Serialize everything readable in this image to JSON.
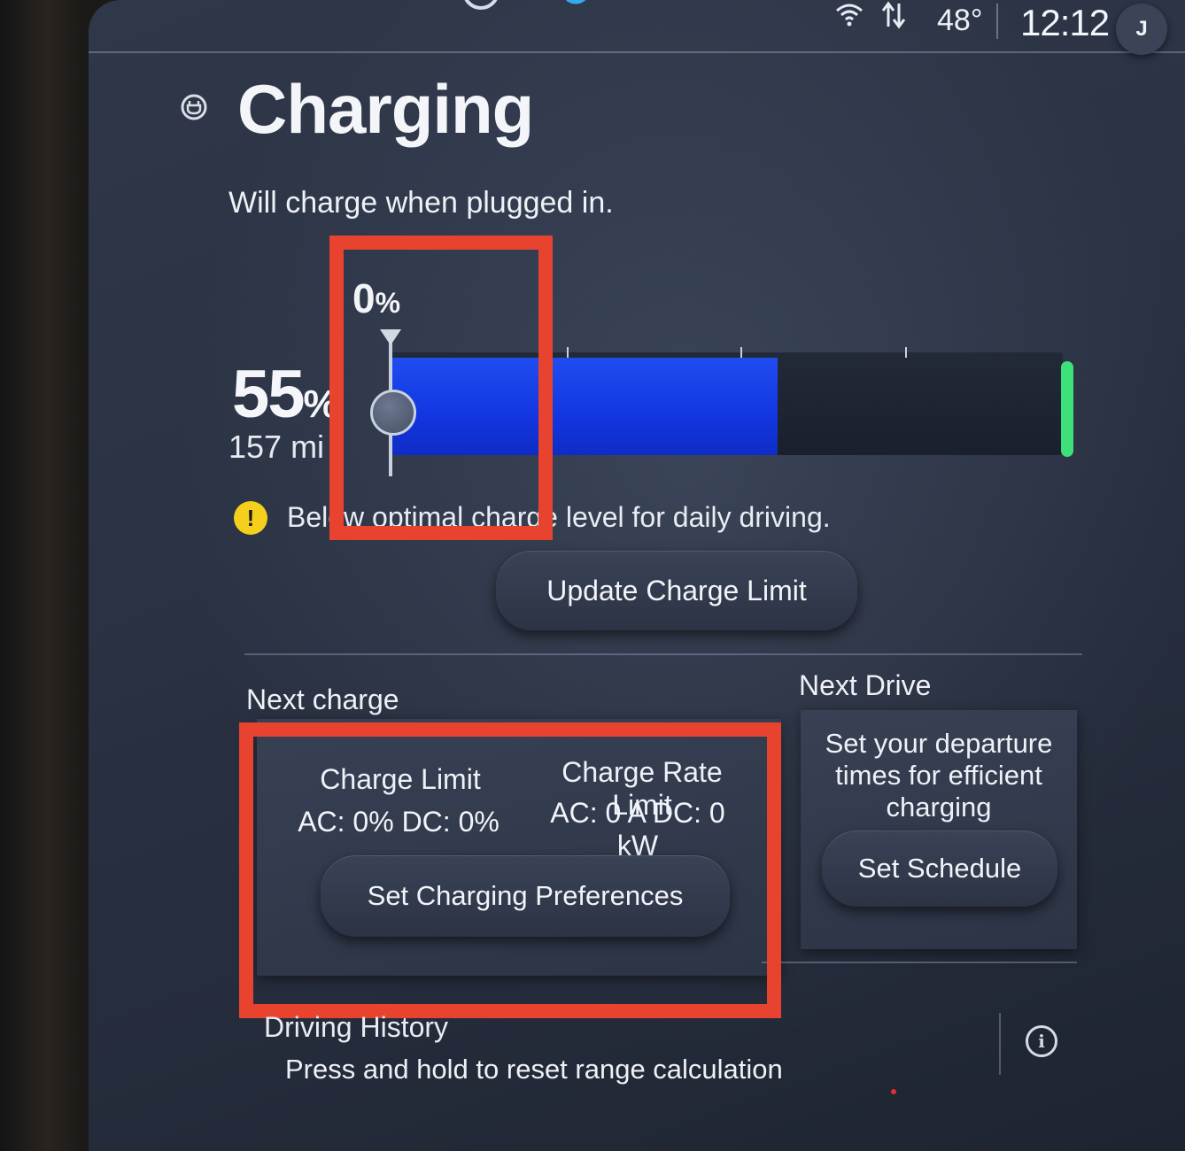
{
  "status_bar": {
    "temperature": "48°",
    "time": "12:12",
    "profile_initial": "J"
  },
  "header": {
    "title": "Charging",
    "status_message": "Will charge when plugged in."
  },
  "battery": {
    "state_of_charge": "55",
    "percent_sign": "%",
    "range": "157 mi",
    "charge_limit_label": "0",
    "charge_limit_unit": "%",
    "charge_fraction": 0.55,
    "colors": {
      "fill": "#1236e0",
      "end_marker": "#3ee07a"
    }
  },
  "warning": {
    "text": "Below optimal charge level for daily driving.",
    "color": "#f4d01c"
  },
  "update_button": {
    "label": "Update Charge Limit"
  },
  "next_charge": {
    "section_label": "Next charge",
    "charge_limit_heading": "Charge Limit",
    "charge_limit_values": "AC: 0% DC: 0%",
    "charge_rate_heading": "Charge Rate Limit",
    "charge_rate_values": "AC: 0 A DC: 0 kW",
    "button_label": "Set Charging Preferences"
  },
  "next_drive": {
    "section_label": "Next Drive",
    "description": "Set your departure times for efficient charging",
    "button_label": "Set Schedule"
  },
  "driving_history": {
    "section_label": "Driving History",
    "instruction": "Press and hold to reset range calculation"
  },
  "annotation_color": "#e8432f"
}
